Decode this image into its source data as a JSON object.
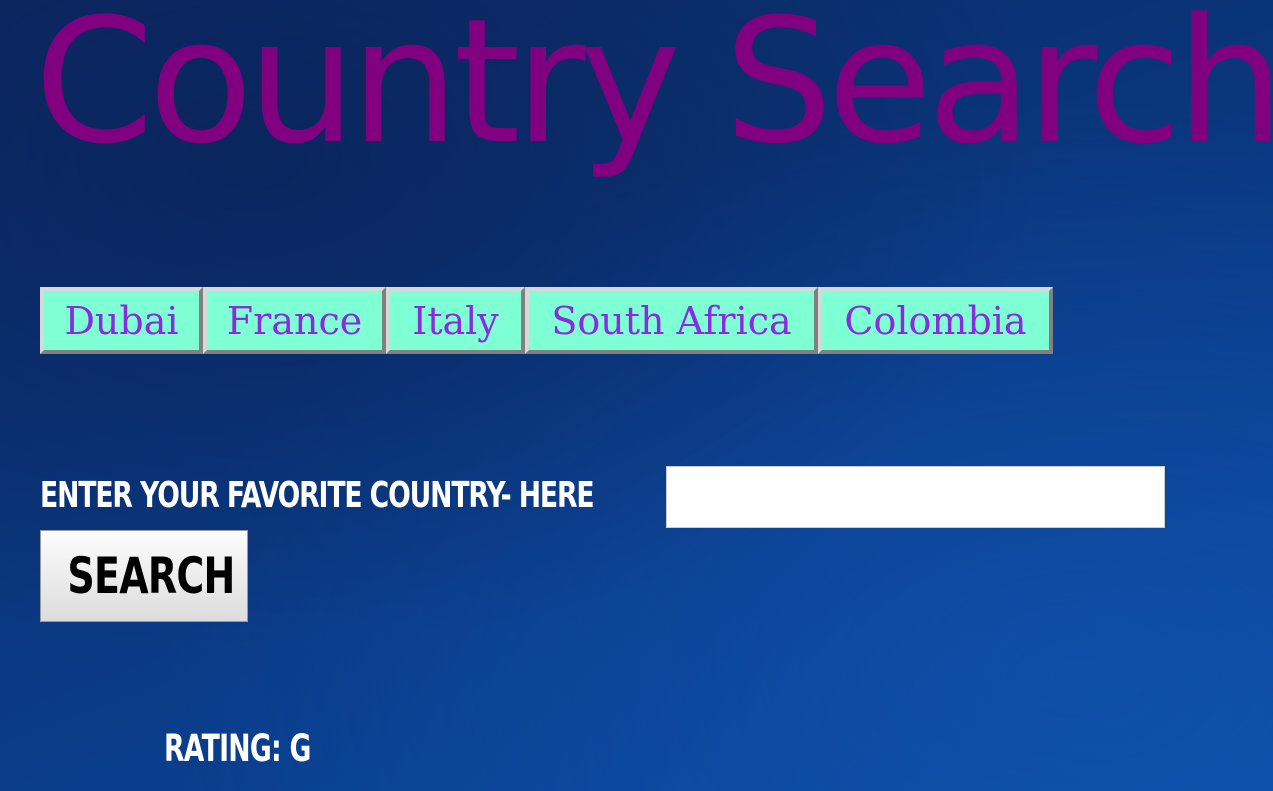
{
  "page": {
    "title": "Country Search"
  },
  "nav": {
    "items": [
      {
        "label": "Dubai"
      },
      {
        "label": "France"
      },
      {
        "label": "Italy"
      },
      {
        "label": "South Africa"
      },
      {
        "label": "Colombia"
      }
    ]
  },
  "search": {
    "label": "Enter your favorite country- here",
    "input_value": "",
    "input_placeholder": "",
    "button_label": "Search"
  },
  "rating": {
    "text": "Rating: G"
  },
  "colors": {
    "title": "#800080",
    "nav_background": "#7fffd4",
    "nav_text": "#8a2be2",
    "page_background": "#0a3378"
  }
}
